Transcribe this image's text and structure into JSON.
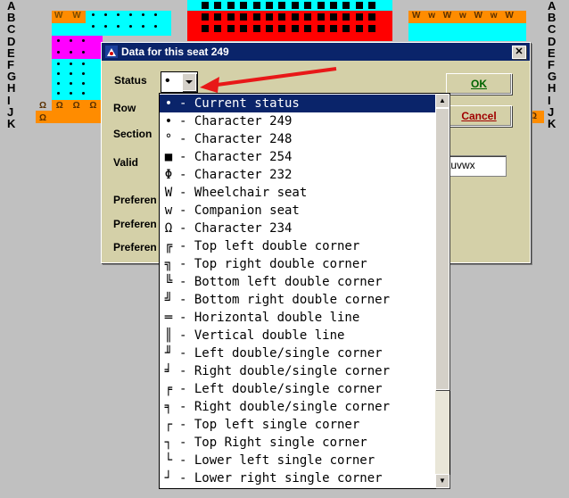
{
  "row_labels": [
    "A",
    "B",
    "C",
    "D",
    "E",
    "F",
    "G",
    "H",
    "I",
    "J",
    "K"
  ],
  "seat_marks": {
    "left_orange_top": "W W",
    "right_orange_top": "W w W w W w W",
    "omega_row": "Ω Ω Ω Ω Ω",
    "omega_right": "Ω"
  },
  "dialog": {
    "title": "Data for this seat  249",
    "close_label": "✕",
    "labels": {
      "status": "Status",
      "row": "Row",
      "section": "Section",
      "valid": "Valid",
      "preference1": "Preferen",
      "preference2": "Preferen",
      "preference3": "Preferen"
    },
    "ok_label": "OK",
    "cancel_label": "Cancel",
    "valid_value": "stuvwx",
    "status_value": "•"
  },
  "dropdown": {
    "options": [
      {
        "glyph": "•",
        "text": "- Current status"
      },
      {
        "glyph": "•",
        "text": "- Character 249"
      },
      {
        "glyph": "°",
        "text": "- Character 248"
      },
      {
        "glyph": "■",
        "text": "- Character 254"
      },
      {
        "glyph": "Φ",
        "text": "- Character 232"
      },
      {
        "glyph": "W",
        "text": "- Wheelchair seat"
      },
      {
        "glyph": "w",
        "text": "- Companion seat"
      },
      {
        "glyph": "Ω",
        "text": "- Character 234"
      },
      {
        "glyph": "╔",
        "text": "- Top left double corner"
      },
      {
        "glyph": "╗",
        "text": "- Top right double corner"
      },
      {
        "glyph": "╚",
        "text": "- Bottom left double corner"
      },
      {
        "glyph": "╝",
        "text": "- Bottom right double corner"
      },
      {
        "glyph": "═",
        "text": "- Horizontal double line"
      },
      {
        "glyph": "║",
        "text": "- Vertical double line"
      },
      {
        "glyph": "╜",
        "text": "- Left double/single corner"
      },
      {
        "glyph": "╛",
        "text": "- Right double/single corner"
      },
      {
        "glyph": "╒",
        "text": "- Left double/single corner"
      },
      {
        "glyph": "╕",
        "text": "- Right double/single corner"
      },
      {
        "glyph": "┌",
        "text": "- Top left single corner"
      },
      {
        "glyph": "┐",
        "text": "- Top Right single corner"
      },
      {
        "glyph": "└",
        "text": "- Lower left single corner"
      },
      {
        "glyph": "┘",
        "text": "- Lower right single corner"
      }
    ]
  },
  "colors": {
    "cyan": "#00ffff",
    "magenta": "#ff00ff",
    "orange": "#ff8c00",
    "red": "#ff0000",
    "titlebar": "#0a246a",
    "arrow": "#e81818"
  },
  "icons": {
    "title": "app-icon",
    "close": "close-icon",
    "arrow": "red-arrow-icon",
    "scroll_up": "scroll-up-icon",
    "scroll_down": "scroll-down-icon",
    "combo": "chevron-down-icon"
  }
}
